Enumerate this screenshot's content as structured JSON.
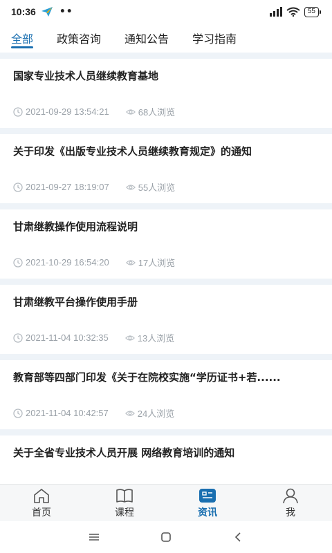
{
  "status": {
    "time": "10:36",
    "dots": "••",
    "battery": "55"
  },
  "tabs": [
    {
      "label": "全部",
      "active": true
    },
    {
      "label": "政策咨询",
      "active": false
    },
    {
      "label": "通知公告",
      "active": false
    },
    {
      "label": "学习指南",
      "active": false
    }
  ],
  "articles": [
    {
      "title": "国家专业技术人员继续教育基地",
      "time": "2021-09-29 13:54:21",
      "views": "68人浏览"
    },
    {
      "title": "关于印发《出版专业技术人员继续教育规定》的通知",
      "time": "2021-09-27 18:19:07",
      "views": "55人浏览"
    },
    {
      "title": "甘肃继教操作使用流程说明",
      "time": "2021-10-29 16:54:20",
      "views": "17人浏览"
    },
    {
      "title": "甘肃继教平台操作使用手册",
      "time": "2021-11-04 10:32:35",
      "views": "13人浏览"
    },
    {
      "title": "教育部等四部门印发《关于在院校实施“学历证书+若......",
      "time": "2021-11-04 10:42:57",
      "views": "24人浏览"
    },
    {
      "title": "关于全省专业技术人员开展 网络教育培训的通知",
      "time": "",
      "views": ""
    }
  ],
  "bottom_nav": [
    {
      "label": "首页",
      "icon": "home-icon"
    },
    {
      "label": "课程",
      "icon": "book-icon"
    },
    {
      "label": "资讯",
      "icon": "news-icon"
    },
    {
      "label": "我",
      "icon": "person-icon"
    }
  ],
  "colors": {
    "accent": "#1a6fb0",
    "background": "#eef3f8",
    "meta_text": "#9aa1a8"
  }
}
